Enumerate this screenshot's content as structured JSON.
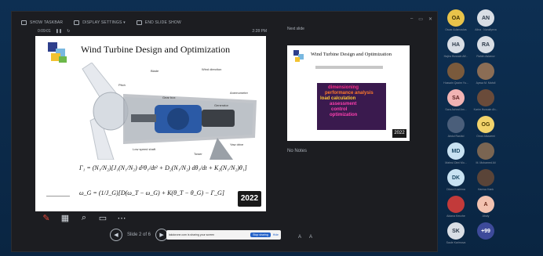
{
  "colors": {
    "frame_bg": "#0b2a4a",
    "app_bg": "#1c1d21",
    "accent_blue": "#2563c9",
    "pen_red": "#e74b3c"
  },
  "topbar": {
    "buttons": [
      {
        "label": "SHOW TASKBAR",
        "icon": "taskbar-icon"
      },
      {
        "label": "DISPLAY SETTINGS ▾",
        "icon": "display-icon"
      },
      {
        "label": "END SLIDE SHOW",
        "icon": "end-show-icon"
      }
    ]
  },
  "current": {
    "timer": "0:09:01",
    "clock": "2:28 PM"
  },
  "slide": {
    "title": "Wind Turbine Design and Optimization",
    "equation_1": "Γ₁ = (N₁/N₂)[J₁(N₁/N₂) d²θ₁/dt² + D₂(N₁/N₂) dθ₁/dt + K₂(N₁/N₂)θ₁]",
    "equation_2": "ω_G = (1/J_G)[D(ω_T − ω_G) + K(θ_T − θ_G) − Γ_G]",
    "badge": "2022"
  },
  "next_slide": {
    "label": "Next slide",
    "title": "Wind Turbine Design and Optimization",
    "lines": [
      "dimensioning",
      "performance analysis",
      "load calculation",
      "assessment",
      "control",
      "optimization"
    ],
    "badge": "2022"
  },
  "notes": "No Notes",
  "controls": {
    "slide_count": "Slide 2 of 6",
    "page_a": "A",
    "page_b": "A"
  },
  "share_bar": {
    "text": "lakdorone.com is sharing your screen",
    "stop": "Stop sharing",
    "hide": "Hide"
  },
  "participants": [
    {
      "initials": "OA",
      "name": "Oscar Adamoulas",
      "color": "#e8c34a",
      "text": "#3b2d00"
    },
    {
      "initials": "AN",
      "name": "Alina · Nuraliyeva",
      "color": "#d9dee5",
      "text": "#2d3a4a"
    },
    {
      "initials": "HA",
      "name": "Hajira Hussain Aff...",
      "color": "#d9dee5",
      "text": "#2d3a4a"
    },
    {
      "initials": "RA",
      "name": "Rahim Aslanov",
      "color": "#d9dee5",
      "text": "#2d3a4a"
    },
    {
      "initials": "",
      "name": "Hussain Qazim Yu...",
      "color": "#7a5a3c",
      "text": "#fff"
    },
    {
      "initials": "",
      "name": "Ayssa M. Mahdi",
      "color": "#8b6d55",
      "text": "#fff"
    },
    {
      "initials": "SA",
      "name": "Sara Ashraf Am...",
      "color": "#f1b3b3",
      "text": "#5a1e1e"
    },
    {
      "initials": "",
      "name": "Karim Hussain Ah...",
      "color": "#6a4b3a",
      "text": "#fff"
    },
    {
      "initials": "",
      "name": "Abdul Rashid",
      "color": "#4a5e7a",
      "text": "#fff"
    },
    {
      "initials": "OG",
      "name": "Omar Alkazemi",
      "color": "#f2d36b",
      "text": "#4a3a00"
    },
    {
      "initials": "MD",
      "name": "Mahrui Dimi Mo...",
      "color": "#c8e2f2",
      "text": "#1d4a66"
    },
    {
      "initials": "",
      "name": "M. Mohamed Ali",
      "color": "#7a6552",
      "text": "#fff"
    },
    {
      "initials": "DK",
      "name": "Dilara Koshima",
      "color": "#c8e2f2",
      "text": "#1d4a66"
    },
    {
      "initials": "",
      "name": "Hamsa Hank",
      "color": "#5a4438",
      "text": "#fff"
    },
    {
      "initials": "",
      "name": "Aidana Kenzhe",
      "color": "#c23a3a",
      "text": "#fff"
    },
    {
      "initials": "A",
      "name": "Abaiy",
      "color": "#f2c2b0",
      "text": "#6a2a1a"
    },
    {
      "initials": "SK",
      "name": "Saule Karimova",
      "color": "#d9dee5",
      "text": "#2d3a4a"
    },
    {
      "initials": "+99",
      "name": "",
      "color": "#3d4a9a",
      "text": "#ffffff"
    }
  ]
}
